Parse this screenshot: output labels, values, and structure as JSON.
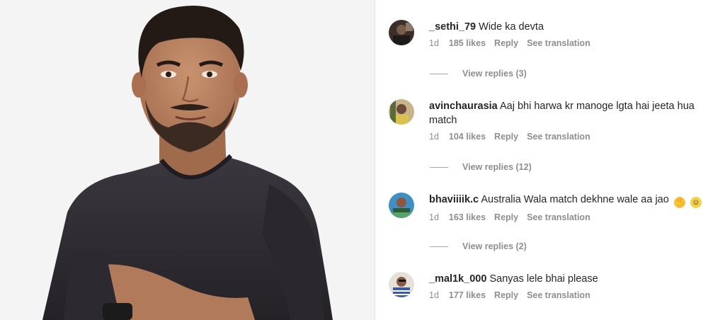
{
  "comments": [
    {
      "username": "_sethi_79",
      "text": "Wide ka devta",
      "age": "1d",
      "likes": "185 likes",
      "reply": "Reply",
      "translate": "See translation",
      "view_replies": "View replies (3)"
    },
    {
      "username": "avinchaurasia",
      "text": "Aaj bhi harwa kr manoge lgta hai jeeta hua match",
      "age": "1d",
      "likes": "104 likes",
      "reply": "Reply",
      "translate": "See translation",
      "view_replies": "View replies (12)"
    },
    {
      "username": "bhaviiiik.c",
      "text": "Australia Wala match dekhne wale aa jao",
      "emojis": [
        "clapping-hands-icon",
        "laughing-face-icon"
      ],
      "age": "1d",
      "likes": "163 likes",
      "reply": "Reply",
      "translate": "See translation",
      "view_replies": "View replies (2)"
    },
    {
      "username": "_mal1k_000",
      "text": "Sanyas lele bhai please",
      "age": "1d",
      "likes": "177 likes",
      "reply": "Reply",
      "translate": "See translation"
    }
  ],
  "colors": {
    "text": "#262626",
    "muted": "#8e8e8e",
    "shirt": "#2f2c33",
    "background": "#f4f4f4"
  }
}
